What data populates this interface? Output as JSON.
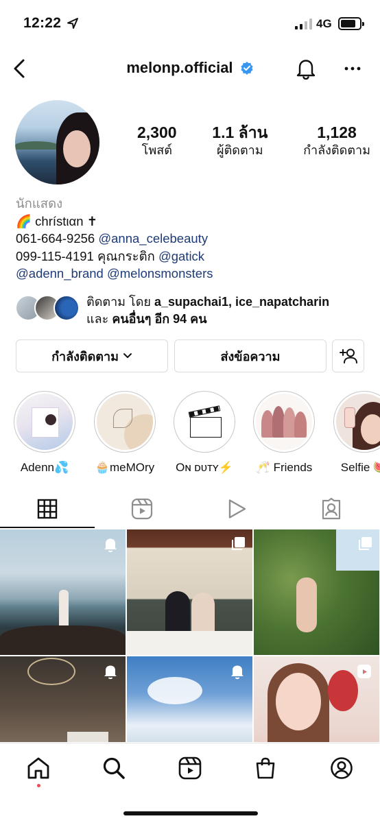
{
  "status_bar": {
    "time": "12:22",
    "network": "4G",
    "battery_level": 0.82
  },
  "header": {
    "username": "melonp.official"
  },
  "stats": [
    {
      "value": "2,300",
      "label": "โพสต์"
    },
    {
      "value": "1.1 ล้าน",
      "label": "ผู้ติดตาม"
    },
    {
      "value": "1,128",
      "label": "กำลังติดตาม"
    }
  ],
  "bio": {
    "category": "นักแสดง",
    "name_line": "🌈 chrístιαn ✝",
    "line1_text": "061-664-9256 ",
    "line1_mention": "@anna_celebeauty",
    "line2_text": "099-115-4191 คุณกระติก ",
    "line2_mention": "@gatick",
    "line3_mention_a": "@adenn_brand",
    "line3_mention_b": "@melonsmonsters"
  },
  "followed_by": {
    "prefix": "ติดตาม โดย ",
    "names": "a_supachai1, ice_napatcharin",
    "line2_prefix": "และ ",
    "others": "คนอื่นๆ อีก 94 คน"
  },
  "buttons": {
    "following": "กำลังติดตาม",
    "message": "ส่งข้อความ"
  },
  "highlights": [
    {
      "label": "Adenn💦"
    },
    {
      "label": "🧁meMOry"
    },
    {
      "label": "Oɴ ᴅᴜᴛʏ⚡️"
    },
    {
      "label": "🥂 Friends"
    },
    {
      "label": "Selfie 🍉"
    }
  ],
  "tabs": [
    {
      "icon": "grid-icon"
    },
    {
      "icon": "reels-icon"
    },
    {
      "icon": "video-play-icon"
    },
    {
      "icon": "tagged-icon"
    }
  ],
  "bottom_nav": [
    {
      "icon": "home-icon"
    },
    {
      "icon": "search-icon"
    },
    {
      "icon": "reels-icon"
    },
    {
      "icon": "shop-icon"
    },
    {
      "icon": "profile-icon"
    }
  ],
  "colors": {
    "verified": "#3897f0",
    "mention": "#1f3b77",
    "notification_dot": "#ed4956",
    "muted": "#8e8e8e"
  }
}
